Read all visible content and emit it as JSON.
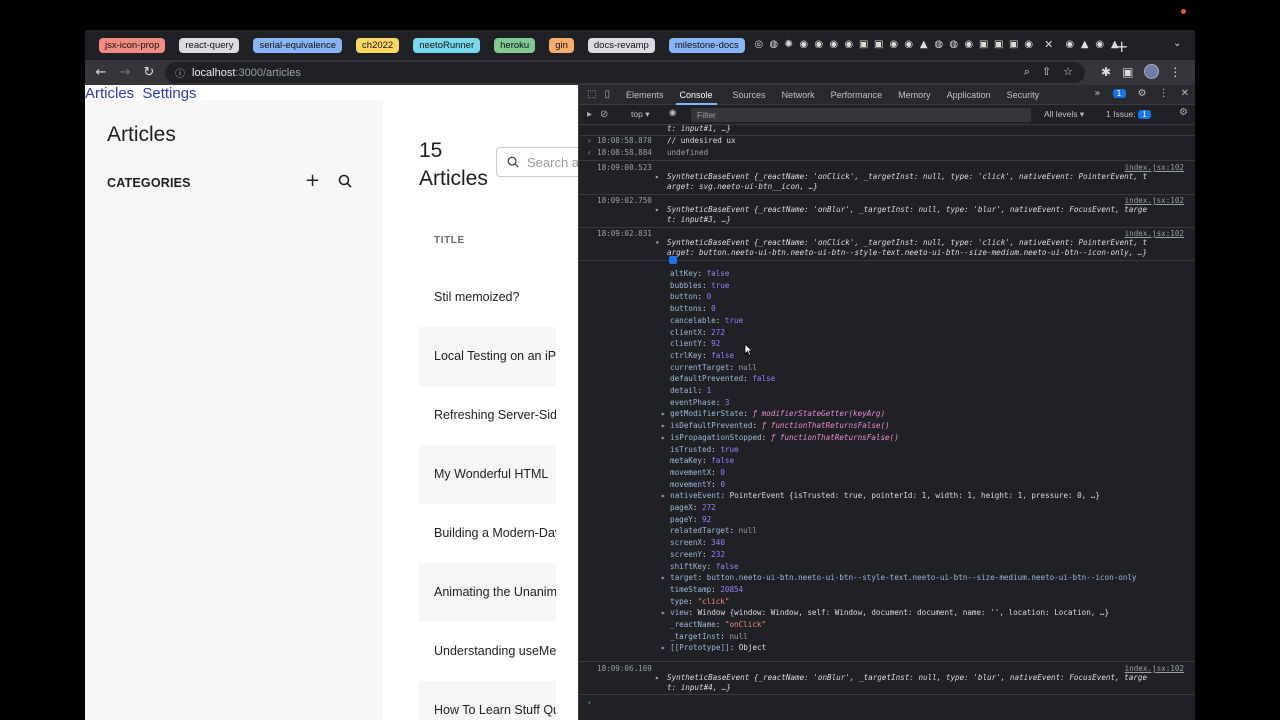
{
  "tab_groups": [
    {
      "label": "jsx-icon-prop",
      "color": "#f28b82"
    },
    {
      "label": "react-query",
      "color": "#dadce0"
    },
    {
      "label": "serial-equivalence",
      "color": "#8ab4f8"
    },
    {
      "label": "ch2022",
      "color": "#fdd663"
    },
    {
      "label": "neetoRunner",
      "color": "#78d9ec"
    },
    {
      "label": "heroku",
      "color": "#81c995"
    },
    {
      "label": "gin",
      "color": "#fcad70"
    },
    {
      "label": "docs-revamp",
      "color": "#dadce0"
    },
    {
      "label": "milestone-docs",
      "color": "#8ab4f8"
    }
  ],
  "address": {
    "host": "localhost",
    "path": ":3000/articles"
  },
  "app": {
    "nav": [
      "Articles",
      "Settings"
    ],
    "sidebar_title": "Articles",
    "categories_label": "CATEGORIES",
    "main_title_count": "15",
    "main_title_word": "Articles",
    "search_placeholder": "Search a",
    "column_header": "TITLE",
    "rows": [
      "Stil memoized?",
      "Local Testing on an iPhone",
      "Refreshing Server-Side",
      "My Wonderful HTML",
      "Building a Modern-Day",
      "Animating the Unanimatable",
      "Understanding useMemo",
      "How To Learn Stuff Quickly"
    ]
  },
  "devtools": {
    "tabs": [
      "Elements",
      "Console",
      "Sources",
      "Network",
      "Performance",
      "Memory",
      "Application",
      "Security"
    ],
    "active_tab": "Console",
    "messages_badge": "1",
    "context": "top",
    "filter_placeholder": "Filter",
    "levels": "All levels",
    "issues": "1 Issue:",
    "issues_count": "1",
    "lines": {
      "l0": "t: input#1, …}",
      "l1_ts": "18:08:58.878",
      "l1": "// undesired ux",
      "l2_ts": "18:08:58.884",
      "l2": "undefined",
      "e1_ts": "18:09:00.523",
      "e1_src": "index.jsx:102",
      "e1_a": "SyntheticBaseEvent {_reactName: 'onClick', _targetInst: null, type: 'click', nativeEvent: PointerEvent, t",
      "e1_b": "arget: svg.neeto-ui-btn__icon, …}",
      "e2_ts": "18:09:02.750",
      "e2_src": "index.jsx:102",
      "e2_a": "SyntheticBaseEvent {_reactName: 'onBlur', _targetInst: null, type: 'blur', nativeEvent: FocusEvent, targe",
      "e2_b": "t: input#3, …}",
      "e3_ts": "18:09:02.831",
      "e3_src": "index.jsx:102",
      "e3_a": "SyntheticBaseEvent {_reactName: 'onClick', _targetInst: null, type: 'click', nativeEvent: PointerEvent, t",
      "e3_b": "arget: button.neeto-ui-btn.neeto-ui-btn--style-text.neeto-ui-btn--size-medium.neeto-ui-btn--icon-only, …}",
      "e4_ts": "18:09:06.169",
      "e4_src": "index.jsx:102",
      "e4_a": "SyntheticBaseEvent {_reactName: 'onBlur', _targetInst: null, type: 'blur', nativeEvent: FocusEvent, targe",
      "e4_b": "t: input#4, …}"
    },
    "props": [
      {
        "k": "altKey",
        "v": "false",
        "t": "b"
      },
      {
        "k": "bubbles",
        "v": "true",
        "t": "b"
      },
      {
        "k": "button",
        "v": "0",
        "t": "n"
      },
      {
        "k": "buttons",
        "v": "0",
        "t": "n"
      },
      {
        "k": "cancelable",
        "v": "true",
        "t": "b"
      },
      {
        "k": "clientX",
        "v": "272",
        "t": "n"
      },
      {
        "k": "clientY",
        "v": "92",
        "t": "n"
      },
      {
        "k": "ctrlKey",
        "v": "false",
        "t": "b"
      },
      {
        "k": "currentTarget",
        "v": "null",
        "t": "nl"
      },
      {
        "k": "defaultPrevented",
        "v": "false",
        "t": "b"
      },
      {
        "k": "detail",
        "v": "1",
        "t": "n"
      },
      {
        "k": "eventPhase",
        "v": "3",
        "t": "n"
      },
      {
        "k": "getModifierState",
        "v": "ƒ modifierStateGetter(keyArg)",
        "t": "f",
        "exp": true
      },
      {
        "k": "isDefaultPrevented",
        "v": "ƒ functionThatReturnsFalse()",
        "t": "f",
        "exp": true
      },
      {
        "k": "isPropagationStopped",
        "v": "ƒ functionThatReturnsFalse()",
        "t": "f",
        "exp": true
      },
      {
        "k": "isTrusted",
        "v": "true",
        "t": "b"
      },
      {
        "k": "metaKey",
        "v": "false",
        "t": "b"
      },
      {
        "k": "movementX",
        "v": "0",
        "t": "n"
      },
      {
        "k": "movementY",
        "v": "0",
        "t": "n"
      },
      {
        "k": "nativeEvent",
        "v": "PointerEvent {isTrusted: true, pointerId: 1, width: 1, height: 1, pressure: 0, …}",
        "t": "o",
        "exp": true
      },
      {
        "k": "pageX",
        "v": "272",
        "t": "n"
      },
      {
        "k": "pageY",
        "v": "92",
        "t": "n"
      },
      {
        "k": "relatedTarget",
        "v": "null",
        "t": "nl"
      },
      {
        "k": "screenX",
        "v": "340",
        "t": "n"
      },
      {
        "k": "screenY",
        "v": "232",
        "t": "n"
      },
      {
        "k": "shiftKey",
        "v": "false",
        "t": "b"
      },
      {
        "k": "target",
        "v": "button.neeto-ui-btn.neeto-ui-btn--style-text.neeto-ui-btn--size-medium.neeto-ui-btn--icon-only",
        "t": "kp",
        "exp": true
      },
      {
        "k": "timeStamp",
        "v": "20854",
        "t": "n"
      },
      {
        "k": "type",
        "v": "\"click\"",
        "t": "str"
      },
      {
        "k": "view",
        "v": "Window {window: Window, self: Window, document: document, name: '', location: Location, …}",
        "t": "o",
        "exp": true
      },
      {
        "k": "_reactName",
        "v": "\"onClick\"",
        "t": "str"
      },
      {
        "k": "_targetInst",
        "v": "null",
        "t": "nl"
      },
      {
        "k": "[[Prototype]]",
        "v": "Object",
        "t": "o",
        "exp": true
      }
    ]
  }
}
